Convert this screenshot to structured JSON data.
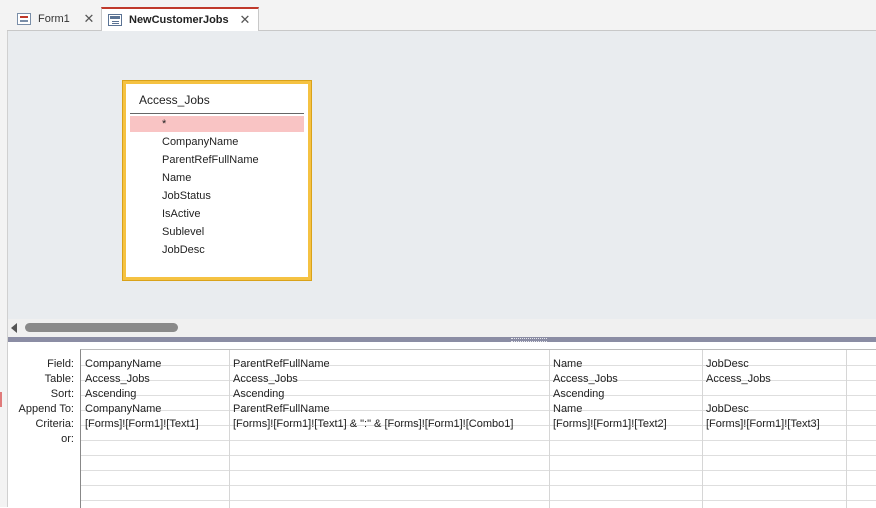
{
  "tabs": [
    {
      "label": "Form1",
      "active": false
    },
    {
      "label": "NewCustomerJobs",
      "active": true
    }
  ],
  "table_box": {
    "title": "Access_Jobs",
    "fields": [
      "*",
      "CompanyName",
      "ParentRefFullName",
      "Name",
      "JobStatus",
      "IsActive",
      "Sublevel",
      "JobDesc"
    ],
    "selected_index": 0
  },
  "grid": {
    "row_labels": [
      "Field:",
      "Table:",
      "Sort:",
      "Append To:",
      "Criteria:",
      "or:"
    ],
    "columns": [
      {
        "field": "CompanyName",
        "table": "Access_Jobs",
        "sort": "Ascending",
        "append_to": "CompanyName",
        "criteria": "[Forms]![Form1]![Text1]",
        "or": ""
      },
      {
        "field": "ParentRefFullName",
        "table": "Access_Jobs",
        "sort": "Ascending",
        "append_to": "ParentRefFullName",
        "criteria": "[Forms]![Form1]![Text1] & \":\" & [Forms]![Form1]![Combo1]",
        "or": ""
      },
      {
        "field": "Name",
        "table": "Access_Jobs",
        "sort": "Ascending",
        "append_to": "Name",
        "criteria": "[Forms]![Form1]![Text2]",
        "or": ""
      },
      {
        "field": "JobDesc",
        "table": "Access_Jobs",
        "sort": "",
        "append_to": "JobDesc",
        "criteria": "[Forms]![Form1]![Text3]",
        "or": ""
      },
      {
        "field": "",
        "table": "",
        "sort": "",
        "append_to": "",
        "criteria": "",
        "or": ""
      }
    ]
  },
  "colors": {
    "accent": "#c0392b",
    "table_border": "#f5c242",
    "selected_field": "#f9c4c4",
    "splitter": "#8b8da4"
  }
}
